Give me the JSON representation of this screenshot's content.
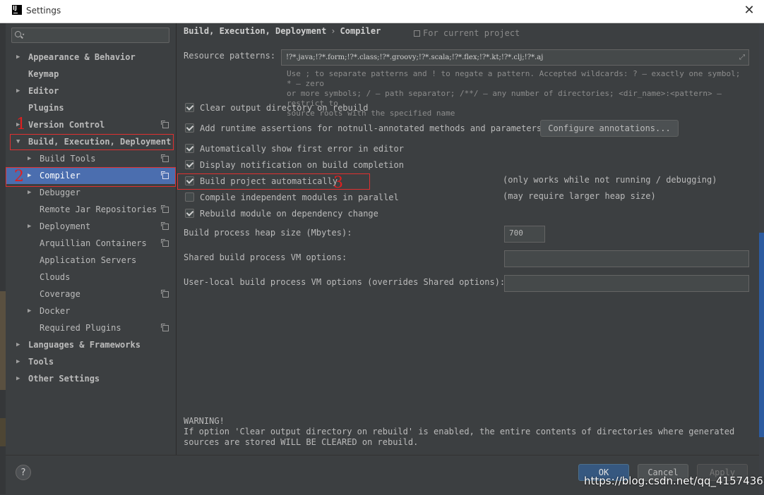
{
  "window": {
    "title": "Settings",
    "logo_text": "IJ"
  },
  "search": {
    "placeholder": ""
  },
  "tree": [
    {
      "label": "Appearance & Behavior",
      "arrow": "▶"
    },
    {
      "label": "Keymap"
    },
    {
      "label": "Editor",
      "arrow": "▶"
    },
    {
      "label": "Plugins"
    },
    {
      "label": "Version Control",
      "arrow": "▶"
    },
    {
      "label": "Build, Execution, Deployment",
      "arrow": "▼"
    },
    {
      "label": "Build Tools",
      "arrow": "▶"
    },
    {
      "label": "Compiler",
      "arrow": "▶"
    },
    {
      "label": "Debugger",
      "arrow": "▶"
    },
    {
      "label": "Remote Jar Repositories"
    },
    {
      "label": "Deployment",
      "arrow": "▶"
    },
    {
      "label": "Arquillian Containers"
    },
    {
      "label": "Application Servers"
    },
    {
      "label": "Clouds"
    },
    {
      "label": "Coverage"
    },
    {
      "label": "Docker",
      "arrow": "▶"
    },
    {
      "label": "Required Plugins"
    },
    {
      "label": "Languages & Frameworks",
      "arrow": "▶"
    },
    {
      "label": "Tools",
      "arrow": "▶"
    },
    {
      "label": "Other Settings",
      "arrow": "▶"
    }
  ],
  "annotations": {
    "m1": "1",
    "m2": "2",
    "m3": "3"
  },
  "breadcrumb": {
    "parent": "Build, Execution, Deployment",
    "separator": "›",
    "current": "Compiler"
  },
  "scope_label": "For current project",
  "resource_patterns": {
    "label": "Resource patterns:",
    "value": "!?*.java;!?*.form;!?*.class;!?*.groovy;!?*.scala;!?*.flex;!?*.kt;!?*.clj;!?*.aj",
    "hint_line1": "Use ; to separate patterns and ! to negate a pattern. Accepted wildcards: ? — exactly one symbol; * — zero",
    "hint_line2": "or more symbols; / — path separator; /**/ — any number of directories; <dir_name>:<pattern> — restrict to",
    "hint_line3": "source roots with the specified name"
  },
  "options": {
    "clear_output": {
      "label": "Clear output directory on rebuild",
      "checked": true
    },
    "runtime_assertions": {
      "label": "Add runtime assertions for notnull-annotated methods and parameters",
      "checked": true
    },
    "configure_annotations": "Configure annotations...",
    "show_first_error": {
      "label": "Automatically show first error in editor",
      "checked": true
    },
    "display_notification": {
      "label": "Display notification on build completion",
      "checked": true
    },
    "build_auto": {
      "label": "Build project automatically",
      "checked": true,
      "note": "(only works while not running / debugging)"
    },
    "compile_parallel": {
      "label": "Compile independent modules in parallel",
      "checked": false,
      "note": "(may require larger heap size)"
    },
    "rebuild_module": {
      "label": "Rebuild module on dependency change",
      "checked": true
    }
  },
  "heap": {
    "label": "Build process heap size (Mbytes):",
    "value": "700"
  },
  "shared_vm": {
    "label": "Shared build process VM options:",
    "value": ""
  },
  "user_vm": {
    "label": "User-local build process VM options (overrides Shared options):",
    "value": ""
  },
  "warning": {
    "title": "WARNING!",
    "line1": "If option 'Clear output directory on rebuild' is enabled, the entire contents of directories where generated",
    "line2": "sources are stored WILL BE CLEARED on rebuild."
  },
  "buttons": {
    "ok": "OK",
    "cancel": "Cancel",
    "apply": "Apply",
    "help": "?"
  },
  "watermark": "https://blog.csdn.net/qq_41574368"
}
